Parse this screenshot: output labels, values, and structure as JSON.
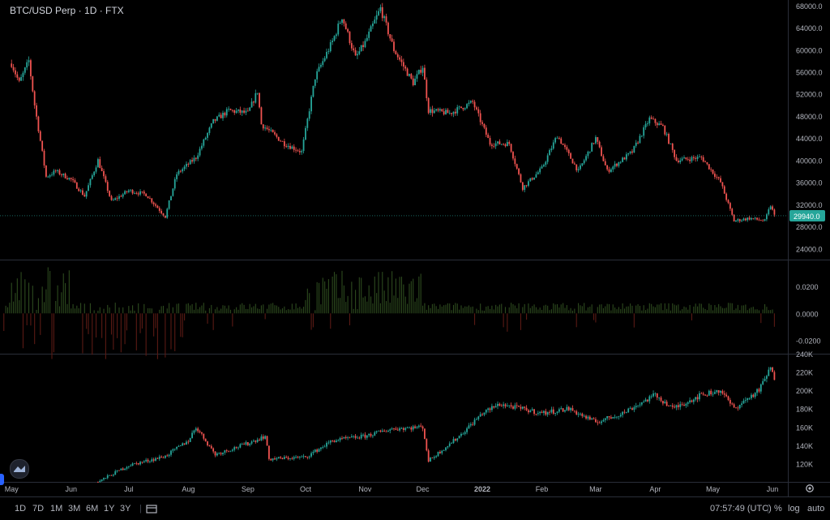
{
  "header": {
    "symbol_title": "BTC/USD Perp · 1D · FTX"
  },
  "chart_data": [
    {
      "type": "candlestick",
      "panel": "price",
      "last_price_label": "29940.0",
      "last_price": 29940,
      "ylim": [
        22000,
        69000
      ],
      "y_ticks": [
        "68000.0",
        "64000.0",
        "60000.0",
        "56000.0",
        "52000.0",
        "48000.0",
        "44000.0",
        "40000.0",
        "36000.0",
        "32000.0",
        "28000.0",
        "24000.0"
      ],
      "y_tick_values": [
        68000,
        64000,
        60000,
        56000,
        52000,
        48000,
        44000,
        40000,
        36000,
        32000,
        28000,
        24000
      ],
      "x_ticks": [
        "May",
        "Jun",
        "Jul",
        "Aug",
        "Sep",
        "Oct",
        "Nov",
        "Dec",
        "2022",
        "Feb",
        "Mar",
        "Apr",
        "May",
        "Jun"
      ],
      "series": [
        {
          "x": "2021-05-01",
          "y": 57500
        },
        {
          "x": "2021-05-05",
          "y": 54000
        },
        {
          "x": "2021-05-10",
          "y": 58000
        },
        {
          "x": "2021-05-13",
          "y": 50000
        },
        {
          "x": "2021-05-19",
          "y": 37000
        },
        {
          "x": "2021-05-24",
          "y": 38000
        },
        {
          "x": "2021-06-01",
          "y": 36500
        },
        {
          "x": "2021-06-08",
          "y": 33500
        },
        {
          "x": "2021-06-15",
          "y": 40000
        },
        {
          "x": "2021-06-22",
          "y": 32500
        },
        {
          "x": "2021-07-01",
          "y": 34500
        },
        {
          "x": "2021-07-10",
          "y": 33800
        },
        {
          "x": "2021-07-20",
          "y": 29800
        },
        {
          "x": "2021-07-26",
          "y": 37500
        },
        {
          "x": "2021-08-05",
          "y": 40500
        },
        {
          "x": "2021-08-14",
          "y": 47000
        },
        {
          "x": "2021-08-22",
          "y": 49000
        },
        {
          "x": "2021-09-01",
          "y": 48500
        },
        {
          "x": "2021-09-06",
          "y": 52500
        },
        {
          "x": "2021-09-08",
          "y": 46500
        },
        {
          "x": "2021-09-20",
          "y": 43000
        },
        {
          "x": "2021-09-29",
          "y": 41500
        },
        {
          "x": "2021-10-06",
          "y": 55000
        },
        {
          "x": "2021-10-15",
          "y": 61500
        },
        {
          "x": "2021-10-20",
          "y": 66000
        },
        {
          "x": "2021-10-27",
          "y": 58500
        },
        {
          "x": "2021-11-01",
          "y": 61300
        },
        {
          "x": "2021-11-09",
          "y": 67500
        },
        {
          "x": "2021-11-16",
          "y": 60000
        },
        {
          "x": "2021-11-26",
          "y": 54000
        },
        {
          "x": "2021-12-01",
          "y": 57000
        },
        {
          "x": "2021-12-04",
          "y": 49000
        },
        {
          "x": "2021-12-15",
          "y": 48500
        },
        {
          "x": "2021-12-27",
          "y": 50500
        },
        {
          "x": "2022-01-05",
          "y": 43000
        },
        {
          "x": "2022-01-15",
          "y": 43000
        },
        {
          "x": "2022-01-22",
          "y": 35000
        },
        {
          "x": "2022-02-01",
          "y": 38500
        },
        {
          "x": "2022-02-09",
          "y": 44500
        },
        {
          "x": "2022-02-20",
          "y": 38000
        },
        {
          "x": "2022-03-01",
          "y": 44000
        },
        {
          "x": "2022-03-07",
          "y": 38000
        },
        {
          "x": "2022-03-20",
          "y": 41500
        },
        {
          "x": "2022-03-29",
          "y": 47500
        },
        {
          "x": "2022-04-05",
          "y": 46000
        },
        {
          "x": "2022-04-12",
          "y": 40000
        },
        {
          "x": "2022-04-25",
          "y": 40500
        },
        {
          "x": "2022-05-05",
          "y": 36000
        },
        {
          "x": "2022-05-12",
          "y": 29000
        },
        {
          "x": "2022-05-20",
          "y": 29500
        },
        {
          "x": "2022-05-28",
          "y": 29000
        },
        {
          "x": "2022-05-31",
          "y": 31800
        },
        {
          "x": "2022-06-02",
          "y": 29940
        }
      ]
    },
    {
      "type": "bar",
      "panel": "oscillator",
      "ylim": [
        -0.03,
        0.04
      ],
      "y_ticks": [
        "0.0200",
        "0.0000",
        "-0.0200"
      ],
      "y_tick_values": [
        0.02,
        0.0,
        -0.02
      ],
      "positive_color": "#2d4a1e",
      "negative_color": "#5a1a14"
    },
    {
      "type": "candlestick",
      "panel": "lower",
      "ylim": [
        100000,
        240000
      ],
      "y_ticks": [
        "240K",
        "220K",
        "200K",
        "180K",
        "160K",
        "140K",
        "120K"
      ],
      "y_tick_values": [
        240000,
        220000,
        200000,
        180000,
        160000,
        140000,
        120000
      ],
      "series": [
        {
          "x": "2021-06-15",
          "y": 100000
        },
        {
          "x": "2021-07-01",
          "y": 118000
        },
        {
          "x": "2021-07-20",
          "y": 128000
        },
        {
          "x": "2021-08-01",
          "y": 145000
        },
        {
          "x": "2021-08-05",
          "y": 160000
        },
        {
          "x": "2021-08-15",
          "y": 130000
        },
        {
          "x": "2021-09-01",
          "y": 142000
        },
        {
          "x": "2021-09-10",
          "y": 150000
        },
        {
          "x": "2021-09-12",
          "y": 125000
        },
        {
          "x": "2021-10-01",
          "y": 127000
        },
        {
          "x": "2021-10-15",
          "y": 145000
        },
        {
          "x": "2021-11-01",
          "y": 150000
        },
        {
          "x": "2021-11-15",
          "y": 158000
        },
        {
          "x": "2021-12-01",
          "y": 160000
        },
        {
          "x": "2021-12-04",
          "y": 123000
        },
        {
          "x": "2021-12-20",
          "y": 150000
        },
        {
          "x": "2022-01-01",
          "y": 175000
        },
        {
          "x": "2022-01-10",
          "y": 185000
        },
        {
          "x": "2022-02-01",
          "y": 175000
        },
        {
          "x": "2022-02-15",
          "y": 180000
        },
        {
          "x": "2022-03-01",
          "y": 165000
        },
        {
          "x": "2022-03-15",
          "y": 175000
        },
        {
          "x": "2022-04-01",
          "y": 195000
        },
        {
          "x": "2022-04-10",
          "y": 180000
        },
        {
          "x": "2022-04-25",
          "y": 195000
        },
        {
          "x": "2022-05-05",
          "y": 200000
        },
        {
          "x": "2022-05-12",
          "y": 180000
        },
        {
          "x": "2022-05-25",
          "y": 200000
        },
        {
          "x": "2022-05-31",
          "y": 225000
        },
        {
          "x": "2022-06-02",
          "y": 210000
        }
      ]
    }
  ],
  "colors": {
    "up": "#26a69a",
    "down": "#ef5350",
    "background": "#000000",
    "grid": "#2a2e39",
    "last_price_bg": "#26a69a"
  },
  "bottom_bar": {
    "timeframes": [
      "1D",
      "7D",
      "1M",
      "3M",
      "6M",
      "1Y",
      "3Y"
    ],
    "clock": "07:57:49 (UTC)",
    "percent_label": "%",
    "log_label": "log",
    "auto_label": "auto"
  }
}
